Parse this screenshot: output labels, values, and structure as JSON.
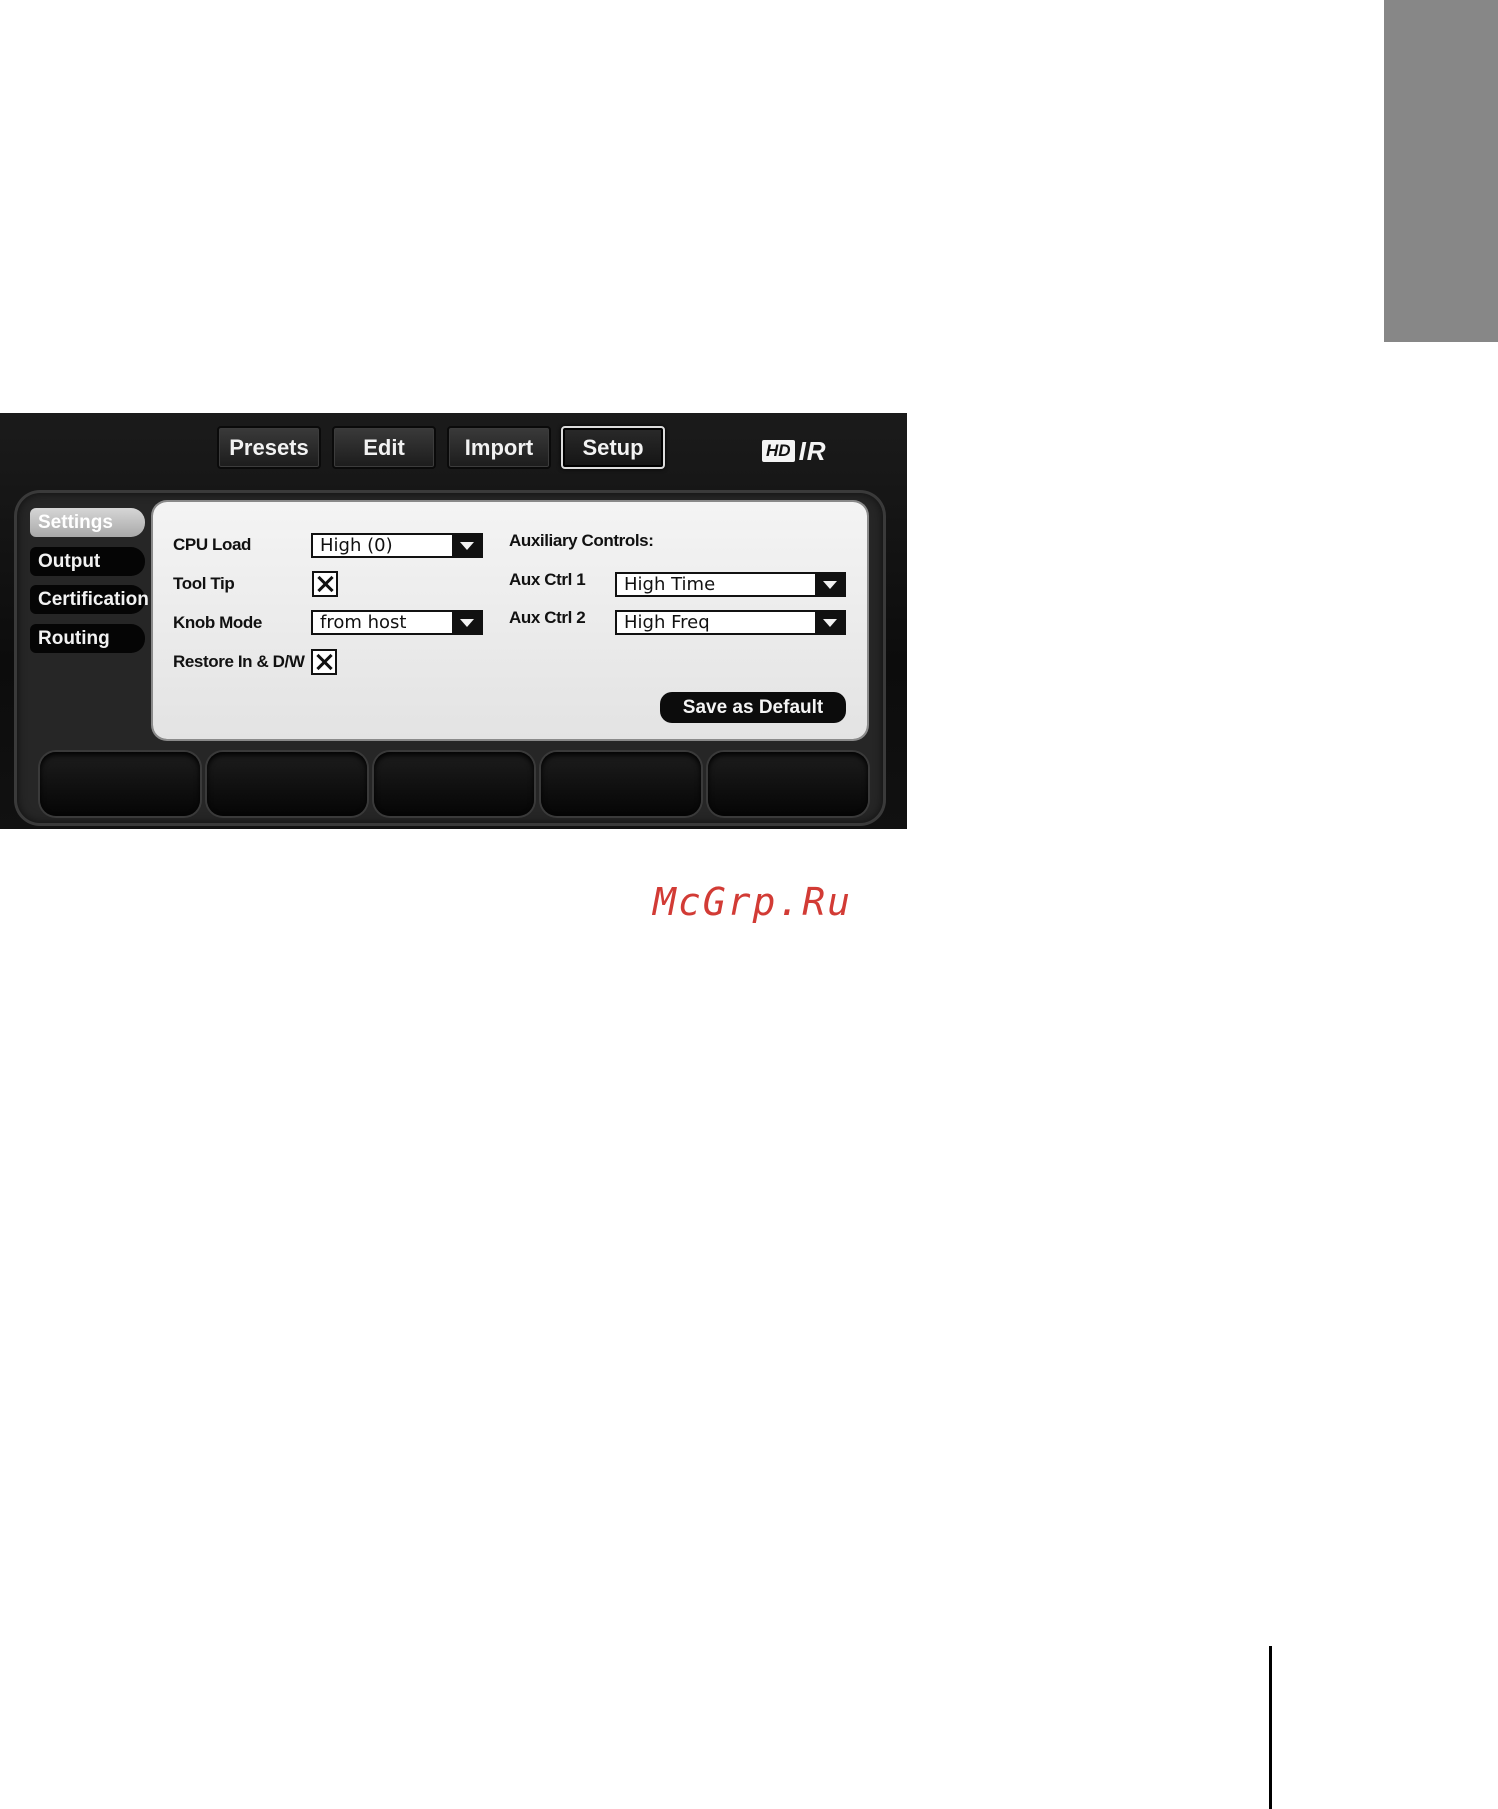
{
  "top_tabs": [
    {
      "label": "Presets"
    },
    {
      "label": "Edit"
    },
    {
      "label": "Import"
    },
    {
      "label": "Setup"
    }
  ],
  "logo": {
    "hd": "HD",
    "ir": "IR"
  },
  "sidebar": [
    {
      "label": "Settings"
    },
    {
      "label": "Output"
    },
    {
      "label": "Certification"
    },
    {
      "label": "Routing"
    }
  ],
  "settings": {
    "cpu_load_label": "CPU Load",
    "cpu_load_value": "High (0)",
    "tool_tip_label": "Tool Tip",
    "knob_mode_label": "Knob Mode",
    "knob_mode_value": "from host",
    "restore_label": "Restore In & D/W",
    "aux_heading": "Auxiliary Controls:",
    "aux1_label": "Aux Ctrl 1",
    "aux1_value": "High Time",
    "aux2_label": "Aux Ctrl 2",
    "aux2_value": "High Freq",
    "save_label": "Save as Default"
  },
  "watermark": "McGrp.Ru",
  "colors": {
    "watermark": "#d23b35",
    "side_tab": "#878787"
  }
}
